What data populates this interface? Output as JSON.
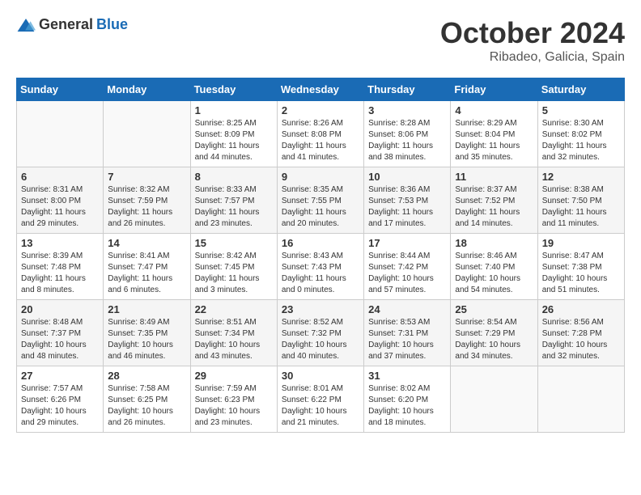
{
  "logo": {
    "general": "General",
    "blue": "Blue"
  },
  "title": "October 2024",
  "subtitle": "Ribadeo, Galicia, Spain",
  "days_header": [
    "Sunday",
    "Monday",
    "Tuesday",
    "Wednesday",
    "Thursday",
    "Friday",
    "Saturday"
  ],
  "weeks": [
    [
      {
        "day": "",
        "content": ""
      },
      {
        "day": "",
        "content": ""
      },
      {
        "day": "1",
        "content": "Sunrise: 8:25 AM\nSunset: 8:09 PM\nDaylight: 11 hours and 44 minutes."
      },
      {
        "day": "2",
        "content": "Sunrise: 8:26 AM\nSunset: 8:08 PM\nDaylight: 11 hours and 41 minutes."
      },
      {
        "day": "3",
        "content": "Sunrise: 8:28 AM\nSunset: 8:06 PM\nDaylight: 11 hours and 38 minutes."
      },
      {
        "day": "4",
        "content": "Sunrise: 8:29 AM\nSunset: 8:04 PM\nDaylight: 11 hours and 35 minutes."
      },
      {
        "day": "5",
        "content": "Sunrise: 8:30 AM\nSunset: 8:02 PM\nDaylight: 11 hours and 32 minutes."
      }
    ],
    [
      {
        "day": "6",
        "content": "Sunrise: 8:31 AM\nSunset: 8:00 PM\nDaylight: 11 hours and 29 minutes."
      },
      {
        "day": "7",
        "content": "Sunrise: 8:32 AM\nSunset: 7:59 PM\nDaylight: 11 hours and 26 minutes."
      },
      {
        "day": "8",
        "content": "Sunrise: 8:33 AM\nSunset: 7:57 PM\nDaylight: 11 hours and 23 minutes."
      },
      {
        "day": "9",
        "content": "Sunrise: 8:35 AM\nSunset: 7:55 PM\nDaylight: 11 hours and 20 minutes."
      },
      {
        "day": "10",
        "content": "Sunrise: 8:36 AM\nSunset: 7:53 PM\nDaylight: 11 hours and 17 minutes."
      },
      {
        "day": "11",
        "content": "Sunrise: 8:37 AM\nSunset: 7:52 PM\nDaylight: 11 hours and 14 minutes."
      },
      {
        "day": "12",
        "content": "Sunrise: 8:38 AM\nSunset: 7:50 PM\nDaylight: 11 hours and 11 minutes."
      }
    ],
    [
      {
        "day": "13",
        "content": "Sunrise: 8:39 AM\nSunset: 7:48 PM\nDaylight: 11 hours and 8 minutes."
      },
      {
        "day": "14",
        "content": "Sunrise: 8:41 AM\nSunset: 7:47 PM\nDaylight: 11 hours and 6 minutes."
      },
      {
        "day": "15",
        "content": "Sunrise: 8:42 AM\nSunset: 7:45 PM\nDaylight: 11 hours and 3 minutes."
      },
      {
        "day": "16",
        "content": "Sunrise: 8:43 AM\nSunset: 7:43 PM\nDaylight: 11 hours and 0 minutes."
      },
      {
        "day": "17",
        "content": "Sunrise: 8:44 AM\nSunset: 7:42 PM\nDaylight: 10 hours and 57 minutes."
      },
      {
        "day": "18",
        "content": "Sunrise: 8:46 AM\nSunset: 7:40 PM\nDaylight: 10 hours and 54 minutes."
      },
      {
        "day": "19",
        "content": "Sunrise: 8:47 AM\nSunset: 7:38 PM\nDaylight: 10 hours and 51 minutes."
      }
    ],
    [
      {
        "day": "20",
        "content": "Sunrise: 8:48 AM\nSunset: 7:37 PM\nDaylight: 10 hours and 48 minutes."
      },
      {
        "day": "21",
        "content": "Sunrise: 8:49 AM\nSunset: 7:35 PM\nDaylight: 10 hours and 46 minutes."
      },
      {
        "day": "22",
        "content": "Sunrise: 8:51 AM\nSunset: 7:34 PM\nDaylight: 10 hours and 43 minutes."
      },
      {
        "day": "23",
        "content": "Sunrise: 8:52 AM\nSunset: 7:32 PM\nDaylight: 10 hours and 40 minutes."
      },
      {
        "day": "24",
        "content": "Sunrise: 8:53 AM\nSunset: 7:31 PM\nDaylight: 10 hours and 37 minutes."
      },
      {
        "day": "25",
        "content": "Sunrise: 8:54 AM\nSunset: 7:29 PM\nDaylight: 10 hours and 34 minutes."
      },
      {
        "day": "26",
        "content": "Sunrise: 8:56 AM\nSunset: 7:28 PM\nDaylight: 10 hours and 32 minutes."
      }
    ],
    [
      {
        "day": "27",
        "content": "Sunrise: 7:57 AM\nSunset: 6:26 PM\nDaylight: 10 hours and 29 minutes."
      },
      {
        "day": "28",
        "content": "Sunrise: 7:58 AM\nSunset: 6:25 PM\nDaylight: 10 hours and 26 minutes."
      },
      {
        "day": "29",
        "content": "Sunrise: 7:59 AM\nSunset: 6:23 PM\nDaylight: 10 hours and 23 minutes."
      },
      {
        "day": "30",
        "content": "Sunrise: 8:01 AM\nSunset: 6:22 PM\nDaylight: 10 hours and 21 minutes."
      },
      {
        "day": "31",
        "content": "Sunrise: 8:02 AM\nSunset: 6:20 PM\nDaylight: 10 hours and 18 minutes."
      },
      {
        "day": "",
        "content": ""
      },
      {
        "day": "",
        "content": ""
      }
    ]
  ]
}
